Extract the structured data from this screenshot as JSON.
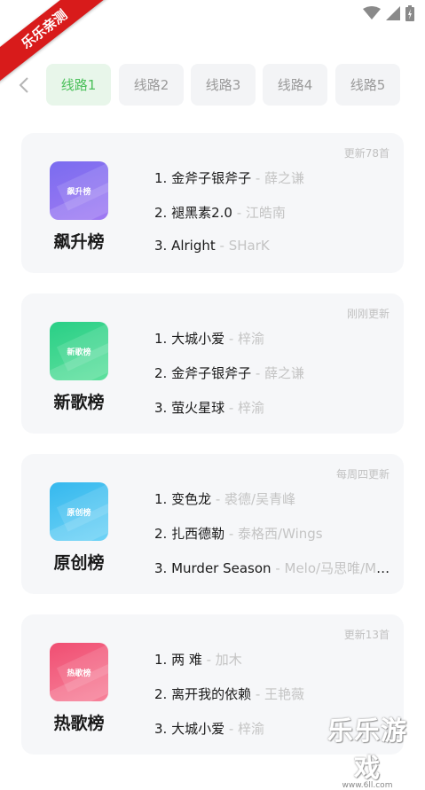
{
  "ribbon_text": "乐乐亲测",
  "nav": {
    "tabs": [
      {
        "label": "线路1",
        "active": true
      },
      {
        "label": "线路2",
        "active": false
      },
      {
        "label": "线路3",
        "active": false
      },
      {
        "label": "线路4",
        "active": false
      },
      {
        "label": "线路5",
        "active": false
      }
    ]
  },
  "charts": [
    {
      "name": "飙升榜",
      "cover_label": "飙升榜",
      "update": "更新78首",
      "songs": [
        {
          "title": "1. 金斧子银斧子",
          "artist": " - 薛之谦"
        },
        {
          "title": "2. 褪黑素2.0",
          "artist": " - 江皓南"
        },
        {
          "title": "3. Alright",
          "artist": " - SHarK"
        }
      ]
    },
    {
      "name": "新歌榜",
      "cover_label": "新歌榜",
      "update": "刚刚更新",
      "songs": [
        {
          "title": "1. 大城小爱",
          "artist": " - 梓渝"
        },
        {
          "title": "2. 金斧子银斧子",
          "artist": " - 薛之谦"
        },
        {
          "title": "3. 萤火星球",
          "artist": " - 梓渝"
        }
      ]
    },
    {
      "name": "原创榜",
      "cover_label": "原创榜",
      "update": "每周四更新",
      "songs": [
        {
          "title": "1. 变色龙",
          "artist": " - 裘德/吴青峰"
        },
        {
          "title": "2. 扎西德勒",
          "artist": " - 泰格西/Wings"
        },
        {
          "title": "3. Murder Season",
          "artist": " - Melo/马思唯/Men..."
        }
      ]
    },
    {
      "name": "热歌榜",
      "cover_label": "热歌榜",
      "update": "更新13首",
      "songs": [
        {
          "title": "1. 两 难",
          "artist": " - 加木"
        },
        {
          "title": "2. 离开我的依赖",
          "artist": " - 王艳薇"
        },
        {
          "title": "3. 大城小爱",
          "artist": " - 梓渝"
        }
      ]
    }
  ],
  "colors": {
    "cover_1": "#8a6cf0",
    "cover_2": "#2fd38a",
    "cover_3": "#3ec1ef",
    "cover_4": "#f2557a",
    "active_tab_text": "#4cc05b"
  },
  "watermark": {
    "title": "乐乐游戏",
    "url": "www.6ll.com"
  }
}
